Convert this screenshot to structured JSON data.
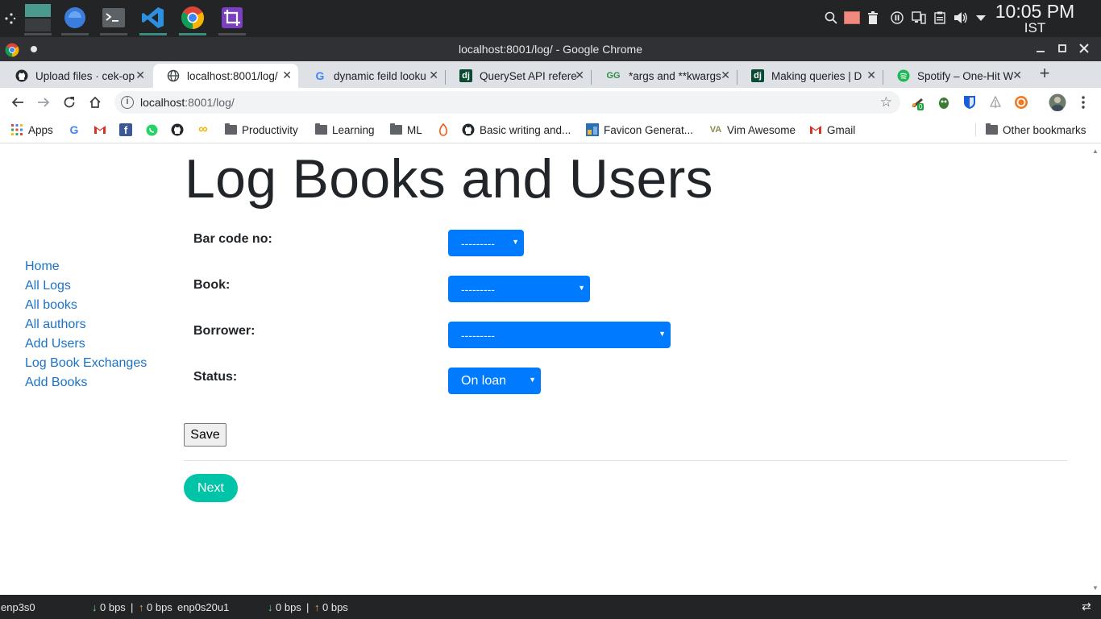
{
  "os_panel": {
    "clock_time": "10:05 PM",
    "clock_tz": "IST"
  },
  "window": {
    "title": "localhost:8001/log/ - Google Chrome"
  },
  "tabs": [
    {
      "label": "Upload files · cek-op",
      "icon": "github-icon"
    },
    {
      "label": "localhost:8001/log/",
      "icon": "globe-icon"
    },
    {
      "label": "dynamic feild looku",
      "icon": "google-icon"
    },
    {
      "label": "QuerySet API refere",
      "icon": "django-icon"
    },
    {
      "label": "*args and **kwargs",
      "icon": "geeksforgeeks-icon"
    },
    {
      "label": "Making queries | D",
      "icon": "django-icon"
    },
    {
      "label": "Spotify – One-Hit W",
      "icon": "spotify-icon"
    }
  ],
  "toolbar": {
    "url_host": "localhost",
    "url_path": ":8001/log/",
    "extension_badge": "0"
  },
  "bookmarks": [
    {
      "label": "Apps",
      "icon": "apps-grid-icon"
    },
    {
      "label": "",
      "icon": "google-icon"
    },
    {
      "label": "",
      "icon": "gmail-icon"
    },
    {
      "label": "",
      "icon": "facebook-icon"
    },
    {
      "label": "",
      "icon": "whatsapp-icon"
    },
    {
      "label": "",
      "icon": "github-icon"
    },
    {
      "label": "",
      "icon": "infinity-icon"
    },
    {
      "label": "Productivity",
      "icon": "folder-icon"
    },
    {
      "label": "Learning",
      "icon": "folder-icon"
    },
    {
      "label": "ML",
      "icon": "folder-icon"
    },
    {
      "label": "",
      "icon": "flame-icon"
    },
    {
      "label": "Basic writing and...",
      "icon": "github-icon"
    },
    {
      "label": "Favicon Generat...",
      "icon": "favicon-icon"
    },
    {
      "label": "Vim Awesome",
      "icon": "vim-icon"
    },
    {
      "label": "Gmail",
      "icon": "gmail-icon"
    },
    {
      "label": "Other bookmarks",
      "icon": "folder-icon"
    }
  ],
  "page": {
    "title": "Log Books and Users",
    "nav": [
      "Home",
      "All Logs",
      "All books",
      "All authors",
      "Add Users",
      "Log Book Exchanges",
      "Add Books"
    ],
    "form": {
      "barcode_label": "Bar code no:",
      "barcode_value": "---------",
      "book_label": "Book:",
      "book_value": "---------",
      "borrower_label": "Borrower:",
      "borrower_value": "---------",
      "status_label": "Status:",
      "status_value": "On loan"
    },
    "save_label": "Save",
    "next_label": "Next"
  },
  "bottom_panel": {
    "iface1": "enp3s0",
    "iface1_down": "0 bps",
    "separator": "|",
    "iface1_up": "0 bps",
    "iface2": "enp0s20u1",
    "iface2_down": "0 bps",
    "iface2_up": "0 bps"
  },
  "colors": {
    "select_blue": "#007bff",
    "next_teal": "#00c4a7",
    "link_blue": "#1a73c7"
  }
}
